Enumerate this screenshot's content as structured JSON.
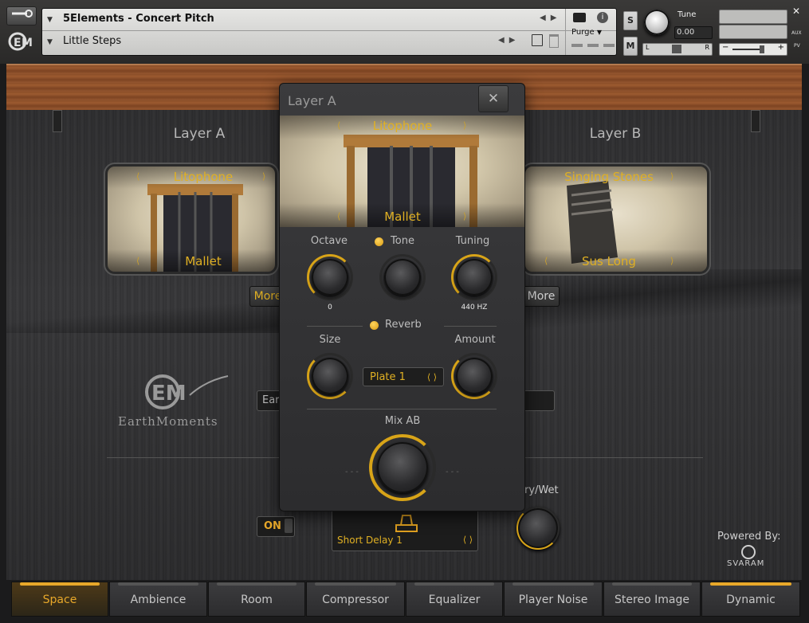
{
  "header": {
    "instrument_name": "5Elements - Concert Pitch",
    "preset_name": "Little Steps",
    "purge_label": "Purge",
    "solo_label": "S",
    "mute_label": "M",
    "tune_label": "Tune",
    "tune_value": "0.00",
    "pan_left": "L",
    "pan_right": "R",
    "aux_label": "AUX",
    "pv_label": "PV",
    "minus": "−",
    "plus": "+"
  },
  "layer_a": {
    "title": "Layer A",
    "instrument": "Litophone",
    "articulation": "Mallet",
    "more_label": "More"
  },
  "layer_b": {
    "title": "Layer B",
    "instrument": "Singing Stones",
    "articulation": "Sus Long",
    "more_label": "More"
  },
  "logo": {
    "brand": "EarthMoments"
  },
  "mid_field": "Ear",
  "popup": {
    "title": "Layer A",
    "close": "✕",
    "instrument": "Litophone",
    "articulation": "Mallet",
    "octave_label": "Octave",
    "octave_value": "0",
    "tone_label": "Tone",
    "tuning_label": "Tuning",
    "tuning_value": "440 HZ",
    "reverb_label": "Reverb",
    "size_label": "Size",
    "amount_label": "Amount",
    "reverb_type": "Plate 1",
    "mix_label": "Mix AB"
  },
  "effects": {
    "on_label": "ON",
    "delay_type": "Short Delay 1",
    "drywet_label": "ry/Wet"
  },
  "powered": {
    "label": "Powered By:",
    "brand": "SVARAM"
  },
  "tabs": [
    {
      "label": "Space"
    },
    {
      "label": "Ambience"
    },
    {
      "label": "Room"
    },
    {
      "label": "Compressor"
    },
    {
      "label": "Equalizer"
    },
    {
      "label": "Player Noise"
    },
    {
      "label": "Stereo Image"
    },
    {
      "label": "Dynamic"
    }
  ],
  "colors": {
    "accent": "#e0b023",
    "wood": "#8a4e28",
    "panel": "#333335"
  },
  "icons": [
    "wrench-icon",
    "em-logo-icon",
    "camera-icon",
    "info-icon",
    "save-icon",
    "trash-icon",
    "close-icon",
    "chevron-left-icon",
    "chevron-right-icon",
    "svaram-logo-icon",
    "delay-icon"
  ]
}
